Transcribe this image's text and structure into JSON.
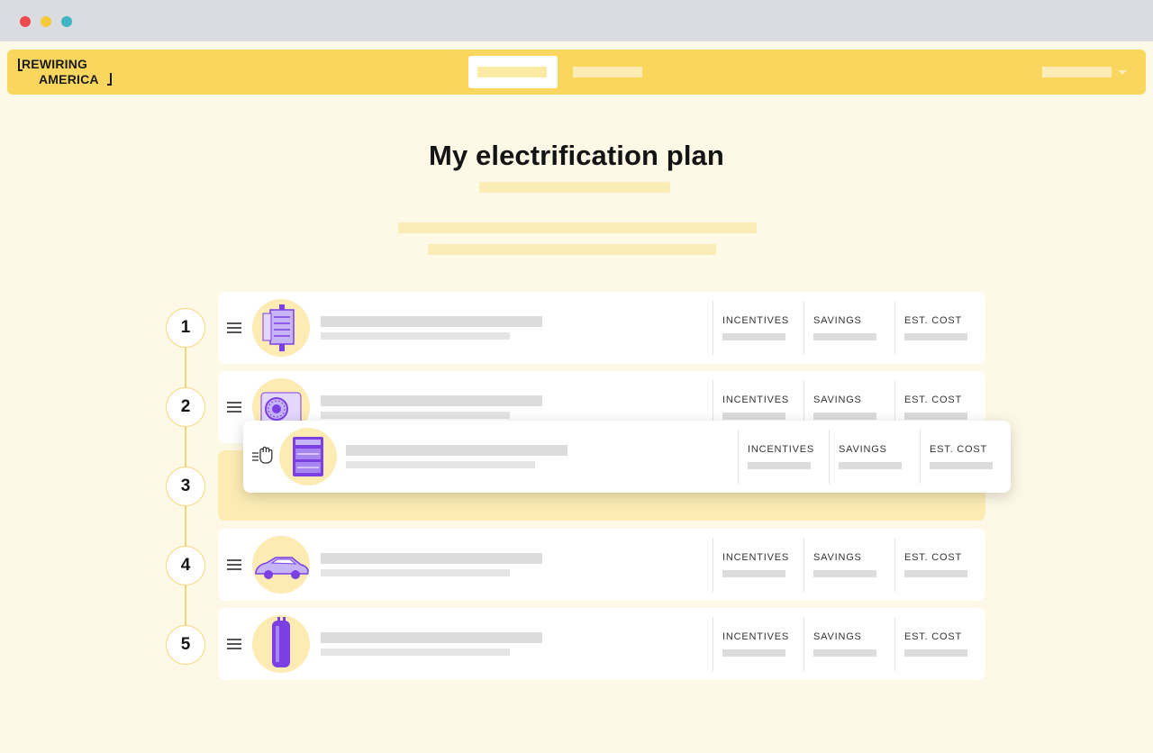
{
  "window": {
    "controls": [
      "close",
      "minimize",
      "maximize"
    ]
  },
  "header": {
    "logo_line1": "REWIRING",
    "logo_line2": "AMERICA"
  },
  "page": {
    "title": "My electrification plan"
  },
  "columns": {
    "incentives": "INCENTIVES",
    "savings": "SAVINGS",
    "est_cost": "EST. COST"
  },
  "steps": [
    {
      "number": "1",
      "icon": "electrical-panel-icon"
    },
    {
      "number": "2",
      "icon": "heat-pump-icon"
    },
    {
      "number": "3",
      "icon": "induction-stove-icon",
      "state": "dragging"
    },
    {
      "number": "4",
      "icon": "electric-car-icon"
    },
    {
      "number": "5",
      "icon": "water-heater-icon"
    }
  ],
  "colors": {
    "accent": "#f9d65e",
    "background": "#fef8e6",
    "placeholder": "#fcedb6",
    "illustration": "#7b3fe4"
  }
}
